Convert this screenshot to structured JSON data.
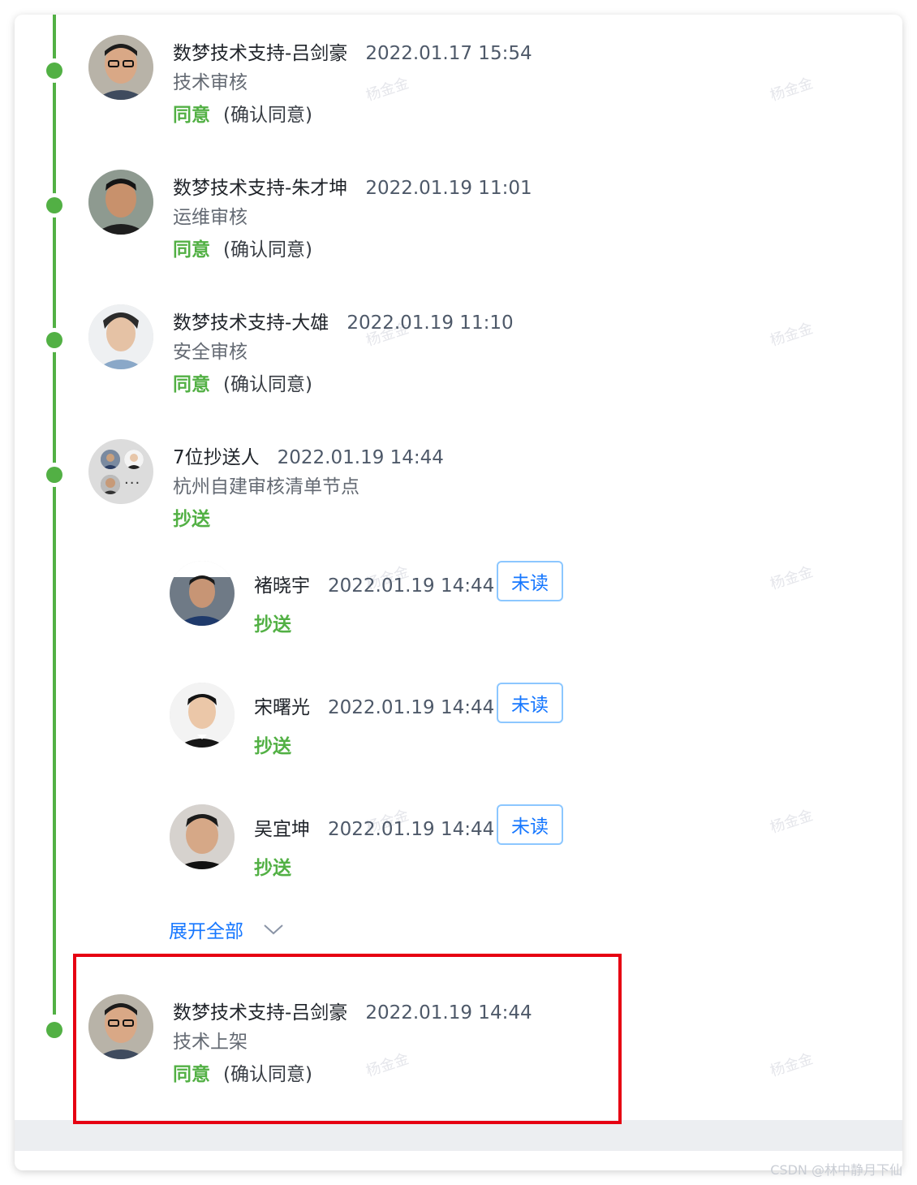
{
  "approvals": [
    {
      "name": "数梦技术支持-吕剑豪",
      "time": "2022.01.17 15:54",
      "role": "技术审核",
      "status": "同意",
      "note": "(确认同意)"
    },
    {
      "name": "数梦技术支持-朱才坤",
      "time": "2022.01.19 11:01",
      "role": "运维审核",
      "status": "同意",
      "note": "(确认同意)"
    },
    {
      "name": "数梦技术支持-大雄",
      "time": "2022.01.19 11:10",
      "role": "安全审核",
      "status": "同意",
      "note": "(确认同意)"
    }
  ],
  "cc_node": {
    "name": "7位抄送人",
    "time": "2022.01.19 14:44",
    "role": "杭州自建审核清单节点",
    "status": "抄送",
    "more": "···"
  },
  "cc_people": [
    {
      "name": "褚晓宇",
      "time": "2022.01.19 14:44",
      "badge": "未读",
      "status": "抄送"
    },
    {
      "name": "宋曙光",
      "time": "2022.01.19 14:44",
      "badge": "未读",
      "status": "抄送"
    },
    {
      "name": "吴宜坤",
      "time": "2022.01.19 14:44",
      "badge": "未读",
      "status": "抄送"
    }
  ],
  "expand_label": "展开全部",
  "final_approval": {
    "name": "数梦技术支持-吕剑豪",
    "time": "2022.01.19 14:44",
    "role": "技术上架",
    "status": "同意",
    "note": "(确认同意)"
  },
  "watermark_text": "杨金金",
  "credit": "CSDN @林中静月下仙",
  "colors": {
    "accent_green": "#52b044",
    "link_blue": "#1677ff",
    "highlight_red": "#e60012"
  }
}
